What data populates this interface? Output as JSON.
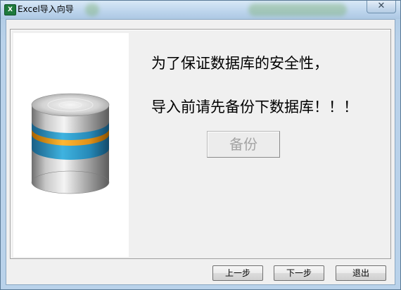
{
  "window": {
    "title": "Excel导入向导",
    "close_glyph": "✕",
    "app_icon_glyph": "X"
  },
  "content": {
    "message_line1": "为了保证数据库的安全性，",
    "message_line2": "导入前请先备份下数据库！！！",
    "backup_button_label": "备份"
  },
  "footer": {
    "prev_label": "上一步",
    "next_label": "下一步",
    "exit_label": "退出"
  },
  "icons": {
    "database": "database-icon"
  },
  "colors": {
    "db_blue": "#2f9fcf",
    "db_orange": "#f0a020",
    "disabled_text": "#a4a4a4"
  }
}
